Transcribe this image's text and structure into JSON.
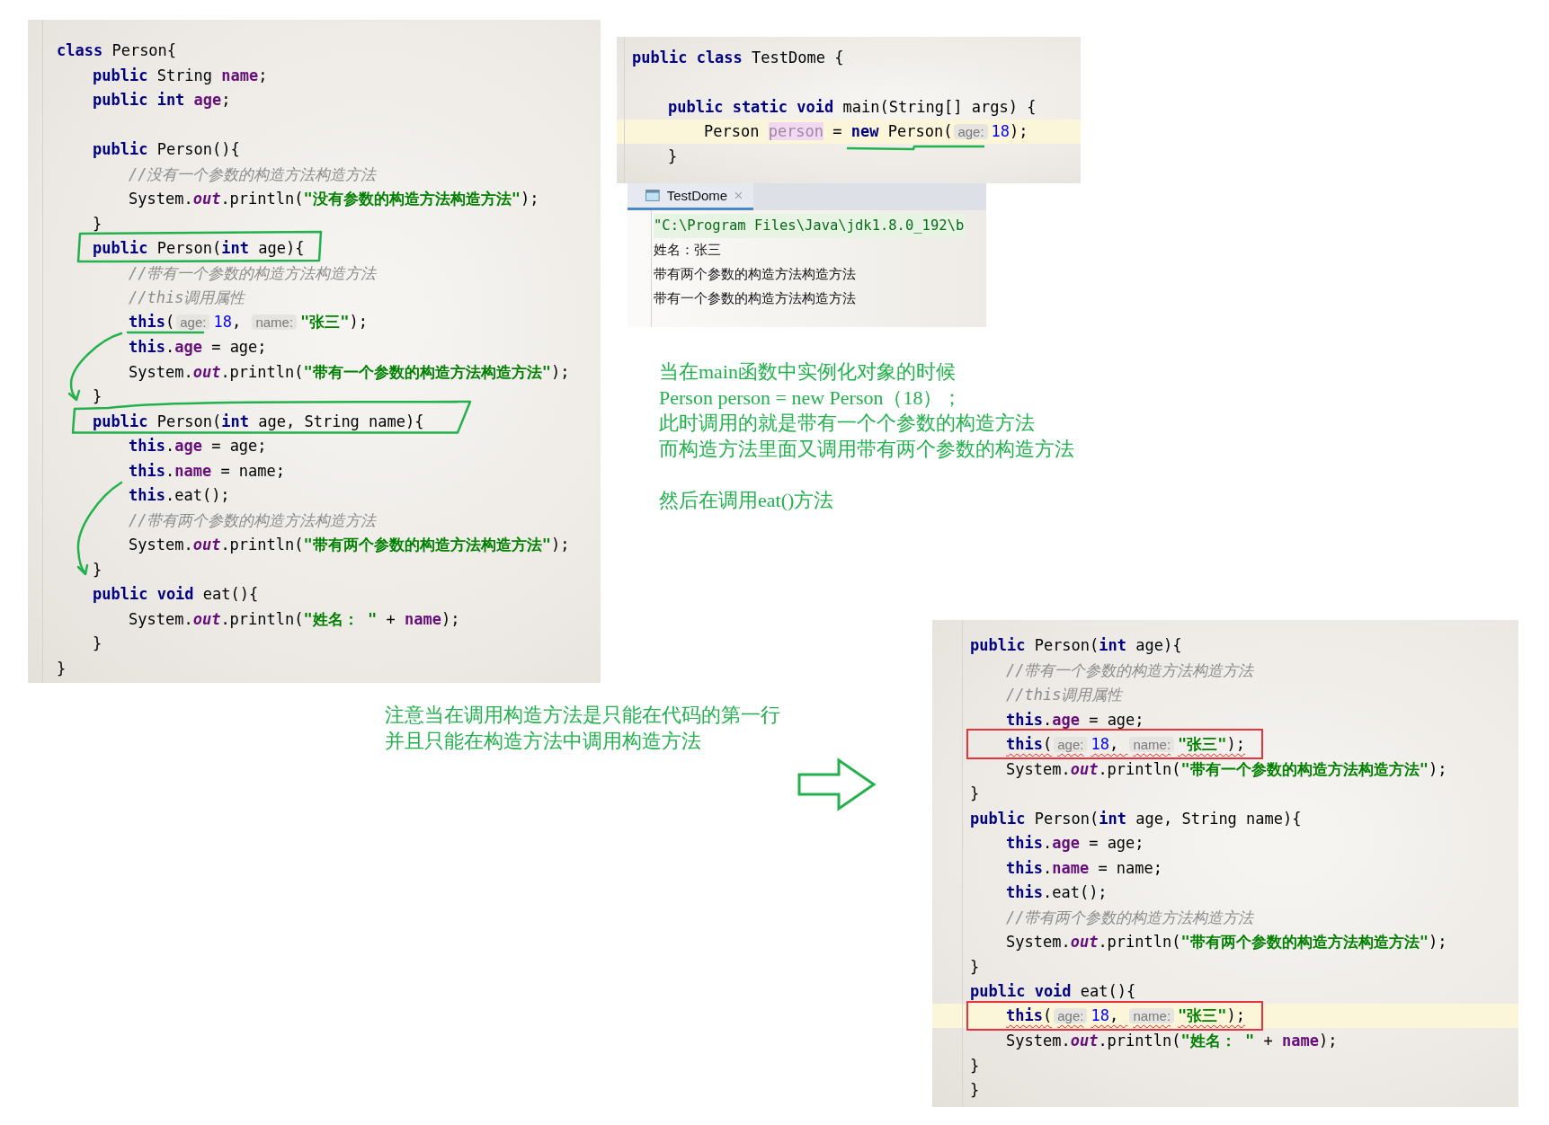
{
  "person_class_editor": {
    "lines": [
      {
        "tokens": [
          {
            "kind": "kw",
            "text": "class"
          },
          {
            "kind": "plain",
            "text": " Person{"
          }
        ],
        "children": [
          {
            "tokens": [
              {
                "kind": "kw",
                "text": "public"
              },
              {
                "kind": "plain",
                "text": " String "
              },
              {
                "kind": "field",
                "text": "name"
              },
              {
                "kind": "plain",
                "text": ";"
              }
            ]
          },
          {
            "tokens": [
              {
                "kind": "kw",
                "text": "public int "
              },
              {
                "kind": "field",
                "text": "age"
              },
              {
                "kind": "plain",
                "text": ";"
              }
            ]
          },
          {
            "blank": true
          },
          {
            "tokens": [
              {
                "kind": "kw",
                "text": "public"
              },
              {
                "kind": "plain",
                "text": " Person(){"
              }
            ],
            "children": [
              {
                "tokens": [
                  {
                    "kind": "comment",
                    "text": "//没有一个参数的构造方法构造方法"
                  }
                ]
              },
              {
                "tokens": [
                  {
                    "kind": "plain",
                    "text": "System."
                  },
                  {
                    "kind": "out",
                    "text": "out"
                  },
                  {
                    "kind": "plain",
                    "text": ".println("
                  },
                  {
                    "kind": "str",
                    "text": "\"没有参数的构造方法构造方法\""
                  },
                  {
                    "kind": "plain",
                    "text": ");"
                  }
                ]
              }
            ]
          },
          {
            "tokens": [
              {
                "kind": "plain",
                "text": "}"
              }
            ]
          },
          {
            "tokens": [
              {
                "kind": "kw",
                "text": "public"
              },
              {
                "kind": "plain",
                "text": " Person("
              },
              {
                "kind": "kw",
                "text": "int"
              },
              {
                "kind": "plain",
                "text": " age){"
              }
            ],
            "children": [
              {
                "tokens": [
                  {
                    "kind": "comment",
                    "text": "//带有一个参数的构造方法构造方法"
                  }
                ]
              },
              {
                "tokens": [
                  {
                    "kind": "comment",
                    "text": "//this调用属性"
                  }
                ]
              },
              {
                "tokens": [
                  {
                    "kind": "kw",
                    "text": "this"
                  },
                  {
                    "kind": "plain",
                    "text": "("
                  },
                  {
                    "kind": "hint",
                    "text": "age:"
                  },
                  {
                    "kind": "num",
                    "text": "18"
                  },
                  {
                    "kind": "plain",
                    "text": ", "
                  },
                  {
                    "kind": "hint",
                    "text": "name:"
                  },
                  {
                    "kind": "str",
                    "text": "\"张三\""
                  },
                  {
                    "kind": "plain",
                    "text": ");"
                  }
                ]
              },
              {
                "tokens": [
                  {
                    "kind": "kw",
                    "text": "this"
                  },
                  {
                    "kind": "plain",
                    "text": "."
                  },
                  {
                    "kind": "field",
                    "text": "age"
                  },
                  {
                    "kind": "plain",
                    "text": " = age;"
                  }
                ]
              },
              {
                "tokens": [
                  {
                    "kind": "plain",
                    "text": "System."
                  },
                  {
                    "kind": "out",
                    "text": "out"
                  },
                  {
                    "kind": "plain",
                    "text": ".println("
                  },
                  {
                    "kind": "str",
                    "text": "\"带有一个参数的构造方法构造方法\""
                  },
                  {
                    "kind": "plain",
                    "text": ");"
                  }
                ]
              }
            ]
          },
          {
            "tokens": [
              {
                "kind": "plain",
                "text": "}"
              }
            ]
          },
          {
            "tokens": [
              {
                "kind": "kw",
                "text": "public"
              },
              {
                "kind": "plain",
                "text": " Person("
              },
              {
                "kind": "kw",
                "text": "int"
              },
              {
                "kind": "plain",
                "text": " age, String name){"
              }
            ],
            "children": [
              {
                "tokens": [
                  {
                    "kind": "kw",
                    "text": "this"
                  },
                  {
                    "kind": "plain",
                    "text": "."
                  },
                  {
                    "kind": "field",
                    "text": "age"
                  },
                  {
                    "kind": "plain",
                    "text": " = age;"
                  }
                ]
              },
              {
                "tokens": [
                  {
                    "kind": "kw",
                    "text": "this"
                  },
                  {
                    "kind": "plain",
                    "text": "."
                  },
                  {
                    "kind": "field",
                    "text": "name"
                  },
                  {
                    "kind": "plain",
                    "text": " = name;"
                  }
                ]
              },
              {
                "tokens": [
                  {
                    "kind": "kw",
                    "text": "this"
                  },
                  {
                    "kind": "plain",
                    "text": ".eat();"
                  }
                ]
              },
              {
                "tokens": [
                  {
                    "kind": "comment",
                    "text": "//带有两个参数的构造方法构造方法"
                  }
                ]
              },
              {
                "tokens": [
                  {
                    "kind": "plain",
                    "text": "System."
                  },
                  {
                    "kind": "out",
                    "text": "out"
                  },
                  {
                    "kind": "plain",
                    "text": ".println("
                  },
                  {
                    "kind": "str",
                    "text": "\"带有两个参数的构造方法构造方法\""
                  },
                  {
                    "kind": "plain",
                    "text": ");"
                  }
                ]
              }
            ]
          },
          {
            "tokens": [
              {
                "kind": "plain",
                "text": "}"
              }
            ]
          },
          {
            "tokens": [
              {
                "kind": "kw",
                "text": "public void"
              },
              {
                "kind": "plain",
                "text": " eat(){"
              }
            ],
            "children": [
              {
                "tokens": [
                  {
                    "kind": "plain",
                    "text": "System."
                  },
                  {
                    "kind": "out",
                    "text": "out"
                  },
                  {
                    "kind": "plain",
                    "text": ".println("
                  },
                  {
                    "kind": "str",
                    "text": "\"姓名： \""
                  },
                  {
                    "kind": "plain",
                    "text": " + "
                  },
                  {
                    "kind": "field",
                    "text": "name"
                  },
                  {
                    "kind": "plain",
                    "text": ");"
                  }
                ]
              }
            ]
          },
          {
            "tokens": [
              {
                "kind": "plain",
                "text": "}"
              }
            ]
          }
        ]
      },
      {
        "tokens": [
          {
            "kind": "plain",
            "text": "}"
          }
        ]
      }
    ]
  },
  "test_editor": {
    "lines": [
      {
        "tokens": [
          {
            "kind": "kw",
            "text": "public class"
          },
          {
            "kind": "plain",
            "text": " TestDome {"
          }
        ],
        "children": [
          {
            "blank": true
          },
          {
            "tokens": [
              {
                "kind": "kw",
                "text": "public static void"
              },
              {
                "kind": "plain",
                "text": " main(String[] args) {"
              }
            ],
            "children": [
              {
                "current": true,
                "tokens": [
                  {
                    "kind": "plain",
                    "text": "Person "
                  },
                  {
                    "kind": "unused",
                    "text": "person"
                  },
                  {
                    "kind": "plain",
                    "text": " = "
                  },
                  {
                    "kind": "kw",
                    "text": "new"
                  },
                  {
                    "kind": "plain",
                    "text": " Person("
                  },
                  {
                    "kind": "hint",
                    "text": "age:"
                  },
                  {
                    "kind": "num",
                    "text": "18"
                  },
                  {
                    "kind": "plain",
                    "text": ");"
                  }
                ]
              }
            ]
          },
          {
            "tokens": [
              {
                "kind": "plain",
                "text": "}"
              }
            ]
          }
        ]
      }
    ]
  },
  "console": {
    "tab": {
      "label": "TestDome",
      "selected": true
    },
    "lines": [
      {
        "kind": "command",
        "text": "\"C:\\Program Files\\Java\\jdk1.8.0_192\\b"
      },
      {
        "kind": "output",
        "text": "姓名：张三"
      },
      {
        "kind": "output",
        "text": "带有两个参数的构造方法构造方法"
      },
      {
        "kind": "output",
        "text": "带有一个参数的构造方法构造方法"
      }
    ]
  },
  "explanation": {
    "paragraphs": [
      {
        "lines": [
          "当在main函数中实例化对象的时候",
          "Person person = new Person（18）；",
          "此时调用的就是带有一个个参数的构造方法",
          "而构造方法里面又调用带有两个参数的构造方法"
        ]
      },
      {
        "lines": [
          "然后在调用eat()方法"
        ]
      }
    ]
  },
  "note": {
    "lines": [
      "注意当在调用构造方法是只能在代码的第一行",
      "并且只能在构造方法中调用构造方法"
    ]
  },
  "detail_editor": {
    "lines": [
      {
        "children": [
          {
            "tokens": [
              {
                "kind": "kw",
                "text": "public"
              },
              {
                "kind": "plain",
                "text": " Person("
              },
              {
                "kind": "kw",
                "text": "int"
              },
              {
                "kind": "plain",
                "text": " age){"
              }
            ],
            "children": [
              {
                "tokens": [
                  {
                    "kind": "comment",
                    "text": "//带有一个参数的构造方法构造方法"
                  }
                ]
              },
              {
                "tokens": [
                  {
                    "kind": "comment",
                    "text": "//this调用属性"
                  }
                ]
              },
              {
                "tokens": [
                  {
                    "kind": "kw",
                    "text": "this"
                  },
                  {
                    "kind": "plain",
                    "text": "."
                  },
                  {
                    "kind": "field",
                    "text": "age"
                  },
                  {
                    "kind": "plain",
                    "text": " = age;"
                  }
                ]
              },
              {
                "marked": true,
                "tokens": [
                  {
                    "kind": "kw",
                    "text": "this"
                  },
                  {
                    "kind": "plain",
                    "text": "("
                  },
                  {
                    "kind": "hint",
                    "text": "age:"
                  },
                  {
                    "kind": "num",
                    "text": "18"
                  },
                  {
                    "kind": "plain",
                    "text": ", "
                  },
                  {
                    "kind": "hint",
                    "text": "name:"
                  },
                  {
                    "kind": "str",
                    "text": "\"张三\""
                  },
                  {
                    "kind": "plain",
                    "text": ");"
                  }
                ]
              },
              {
                "tokens": [
                  {
                    "kind": "plain",
                    "text": "System."
                  },
                  {
                    "kind": "out",
                    "text": "out"
                  },
                  {
                    "kind": "plain",
                    "text": ".println("
                  },
                  {
                    "kind": "str",
                    "text": "\"带有一个参数的构造方法构造方法\""
                  },
                  {
                    "kind": "plain",
                    "text": ");"
                  }
                ]
              }
            ]
          },
          {
            "tokens": [
              {
                "kind": "plain",
                "text": "}"
              }
            ]
          },
          {
            "tokens": [
              {
                "kind": "kw",
                "text": "public"
              },
              {
                "kind": "plain",
                "text": " Person("
              },
              {
                "kind": "kw",
                "text": "int"
              },
              {
                "kind": "plain",
                "text": " age, String name){"
              }
            ],
            "children": [
              {
                "tokens": [
                  {
                    "kind": "kw",
                    "text": "this"
                  },
                  {
                    "kind": "plain",
                    "text": "."
                  },
                  {
                    "kind": "field",
                    "text": "age"
                  },
                  {
                    "kind": "plain",
                    "text": " = age;"
                  }
                ]
              },
              {
                "tokens": [
                  {
                    "kind": "kw",
                    "text": "this"
                  },
                  {
                    "kind": "plain",
                    "text": "."
                  },
                  {
                    "kind": "field",
                    "text": "name"
                  },
                  {
                    "kind": "plain",
                    "text": " = name;"
                  }
                ]
              },
              {
                "tokens": [
                  {
                    "kind": "kw",
                    "text": "this"
                  },
                  {
                    "kind": "plain",
                    "text": ".eat();"
                  }
                ]
              },
              {
                "tokens": [
                  {
                    "kind": "comment",
                    "text": "//带有两个参数的构造方法构造方法"
                  }
                ]
              },
              {
                "tokens": [
                  {
                    "kind": "plain",
                    "text": "System."
                  },
                  {
                    "kind": "out",
                    "text": "out"
                  },
                  {
                    "kind": "plain",
                    "text": ".println("
                  },
                  {
                    "kind": "str",
                    "text": "\"带有两个参数的构造方法构造方法\""
                  },
                  {
                    "kind": "plain",
                    "text": ");"
                  }
                ]
              }
            ]
          },
          {
            "tokens": [
              {
                "kind": "plain",
                "text": "}"
              }
            ]
          },
          {
            "tokens": [
              {
                "kind": "kw",
                "text": "public void"
              },
              {
                "kind": "plain",
                "text": " eat(){"
              }
            ],
            "children": [
              {
                "marked": true,
                "current": true,
                "tokens": [
                  {
                    "kind": "kw",
                    "text": "this"
                  },
                  {
                    "kind": "plain",
                    "text": "("
                  },
                  {
                    "kind": "hint",
                    "text": "age:"
                  },
                  {
                    "kind": "num",
                    "text": "18"
                  },
                  {
                    "kind": "plain",
                    "text": ", "
                  },
                  {
                    "kind": "hint",
                    "text": "name:"
                  },
                  {
                    "kind": "str",
                    "text": "\"张三\""
                  },
                  {
                    "kind": "plain",
                    "text": ");"
                  }
                ]
              },
              {
                "tokens": [
                  {
                    "kind": "plain",
                    "text": "System."
                  },
                  {
                    "kind": "out",
                    "text": "out"
                  },
                  {
                    "kind": "plain",
                    "text": ".println("
                  },
                  {
                    "kind": "str",
                    "text": "\"姓名： \""
                  },
                  {
                    "kind": "plain",
                    "text": " + "
                  },
                  {
                    "kind": "field",
                    "text": "name"
                  },
                  {
                    "kind": "plain",
                    "text": ");"
                  }
                ]
              }
            ]
          },
          {
            "tokens": [
              {
                "kind": "plain",
                "text": "}"
              }
            ]
          }
        ]
      },
      {
        "tokens": [
          {
            "kind": "plain",
            "text": "}"
          }
        ]
      }
    ]
  }
}
